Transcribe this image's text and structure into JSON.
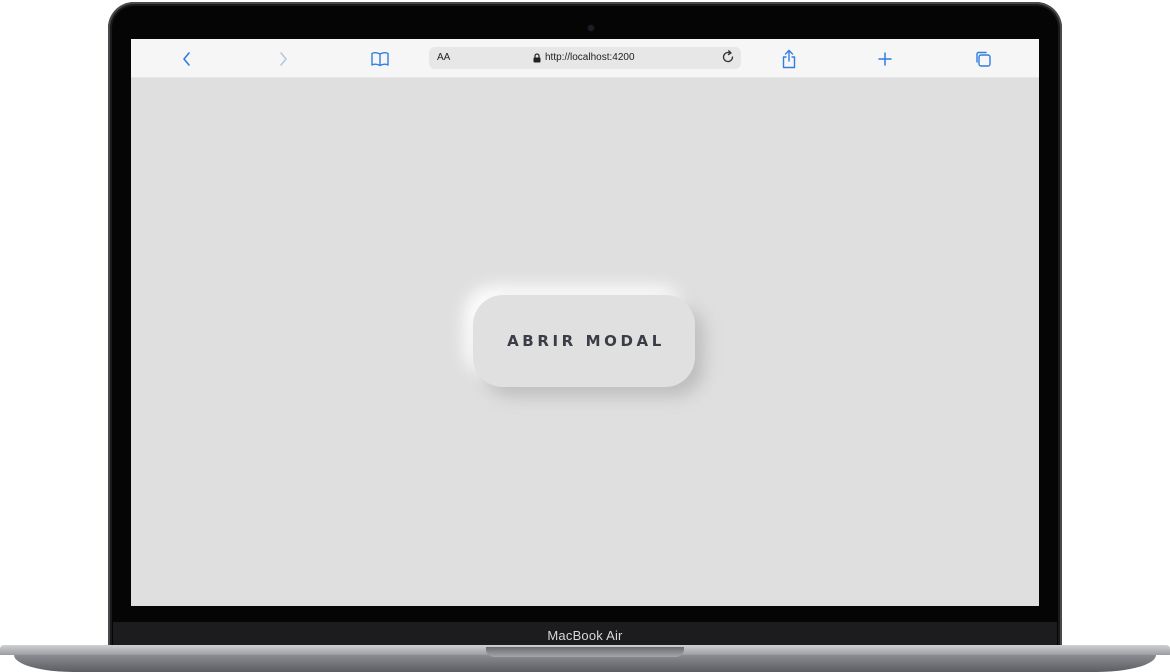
{
  "device": {
    "label": "MacBook Air"
  },
  "browser": {
    "text_size_label": "AA",
    "url": "http://localhost:4200",
    "icons": {
      "back": "chevron-left-icon",
      "forward": "chevron-right-icon",
      "bookmarks": "book-icon",
      "lock": "lock-icon",
      "reload": "reload-icon",
      "share": "share-icon",
      "new_tab": "plus-icon",
      "tabs": "tabs-icon"
    },
    "colors": {
      "accent": "#2f7de1",
      "disabled": "#b5c8e0"
    }
  },
  "page": {
    "button_label": "ABRIR MODAL",
    "background": "#dfdfdf"
  }
}
